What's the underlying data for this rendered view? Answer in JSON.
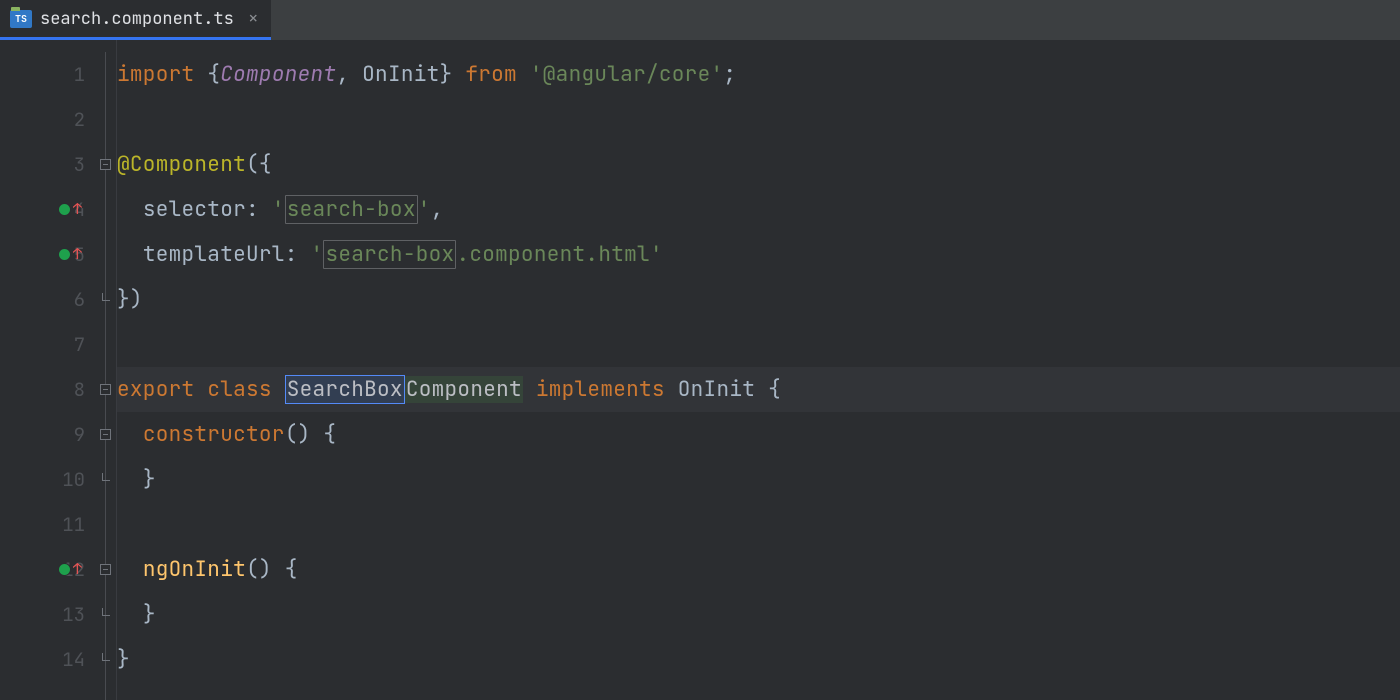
{
  "tab": {
    "icon_label": "TS",
    "title": "search.component.ts",
    "close": "×"
  },
  "gutter": {
    "lines": [
      "1",
      "2",
      "3",
      "4",
      "5",
      "6",
      "7",
      "8",
      "9",
      "10",
      "11",
      "12",
      "13",
      "14"
    ],
    "markers": {
      "4": true,
      "5": true,
      "12": true
    }
  },
  "code": {
    "l1": {
      "import": "import ",
      "lb": "{",
      "component": "Component",
      "comma": ", ",
      "oninit": "OnInit",
      "rb": "}",
      "from": " from ",
      "q1": "'",
      "mod": "@angular/core",
      "q2": "'",
      "semi": ";"
    },
    "l3": {
      "dec": "@Component",
      "open": "({"
    },
    "l4": {
      "indent": "  ",
      "key": "selector",
      "colon": ": ",
      "q": "'",
      "val": "search-box",
      "q2": "'",
      "comma": ","
    },
    "l5": {
      "indent": "  ",
      "key": "templateUrl",
      "colon": ": ",
      "q": "'",
      "val1": "search-box",
      "val2": ".component.html",
      "q2": "'"
    },
    "l6": {
      "close": "})"
    },
    "l8": {
      "export": "export ",
      "class": "class ",
      "name1": "SearchBox",
      "name2": "Component",
      "impl": " implements ",
      "oninit": "OnInit ",
      "brace": "{"
    },
    "l9": {
      "indent": "  ",
      "ctor": "constructor",
      "rest": "() {"
    },
    "l10": {
      "indent": "  ",
      "brace": "}"
    },
    "l12": {
      "indent": "  ",
      "fn": "ngOnInit",
      "rest": "() {"
    },
    "l13": {
      "indent": "  ",
      "brace": "}"
    },
    "l14": {
      "brace": "}"
    }
  }
}
